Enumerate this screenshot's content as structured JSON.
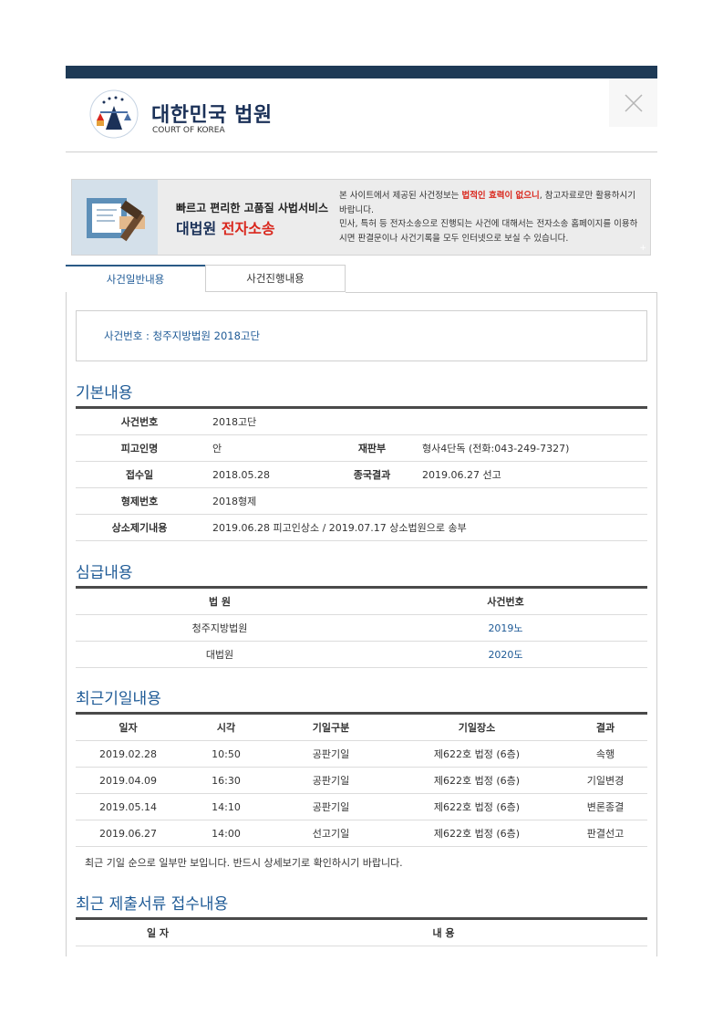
{
  "header": {
    "logo_title": "대한민국 법원",
    "logo_subtitle": "COURT OF KOREA"
  },
  "banner": {
    "slogan": "빠르고 편리한 고품질 사법서비스",
    "brand_prefix": "대법원 ",
    "brand_highlight": "전자소송",
    "notice_part1": "본 사이트에서 제공된 사건정보는 ",
    "notice_strong": "법적인 효력이 없으니",
    "notice_part2": ", 참고자료로만 활용하시기 바랍니다.",
    "notice_line2": "민사, 특허 등 전자소송으로 진행되는 사건에 대해서는 전자소송 홈페이지를 이용하시면 판결문이나 사건기록을 모두 인터넷으로 보실 수 있습니다.",
    "plus": "+"
  },
  "tabs": [
    {
      "label": "사건일반내용"
    },
    {
      "label": "사건진행내용"
    }
  ],
  "case_number_line": "사건번호 : 청주지방법원 2018고단",
  "basic": {
    "title": "기본내용",
    "labels": {
      "case_no": "사건번호",
      "defendant": "피고인명",
      "division": "재판부",
      "received": "접수일",
      "final_result": "종국결과",
      "sentence_no": "형제번호",
      "appeal": "상소제기내용"
    },
    "values": {
      "case_no": "2018고단",
      "defendant": "안",
      "division": "형사4단독 (전화:043-249-7327)",
      "received": "2018.05.28",
      "final_result": "2019.06.27 선고",
      "sentence_no": "2018형제",
      "appeal": "2019.06.28 피고인상소 / 2019.07.17 상소법원으로 송부"
    }
  },
  "trial_levels": {
    "title": "심급내용",
    "headers": [
      "법 원",
      "사건번호"
    ],
    "rows": [
      {
        "court": "청주지방법원",
        "case_no": "2019노"
      },
      {
        "court": "대법원",
        "case_no": "2020도"
      }
    ]
  },
  "hearings": {
    "title": "최근기일내용",
    "headers": [
      "일자",
      "시각",
      "기일구분",
      "기일장소",
      "결과"
    ],
    "rows": [
      {
        "date": "2019.02.28",
        "time": "10:50",
        "type": "공판기일",
        "place": "제622호 법정 (6층)",
        "result": "속행"
      },
      {
        "date": "2019.04.09",
        "time": "16:30",
        "type": "공판기일",
        "place": "제622호 법정 (6층)",
        "result": "기일변경"
      },
      {
        "date": "2019.05.14",
        "time": "14:10",
        "type": "공판기일",
        "place": "제622호 법정 (6층)",
        "result": "변론종결"
      },
      {
        "date": "2019.06.27",
        "time": "14:00",
        "type": "선고기일",
        "place": "제622호 법정 (6층)",
        "result": "판결선고"
      }
    ],
    "note": "최근 기일 순으로 일부만 보입니다. 반드시 상세보기로 확인하시기 바랍니다."
  },
  "documents": {
    "title": "최근 제출서류 접수내용",
    "headers": [
      "일 자",
      "내 용"
    ]
  },
  "colors": {
    "navy": "#1e3a56",
    "link_blue": "#1e5a96",
    "alert_red": "#d9261c"
  }
}
